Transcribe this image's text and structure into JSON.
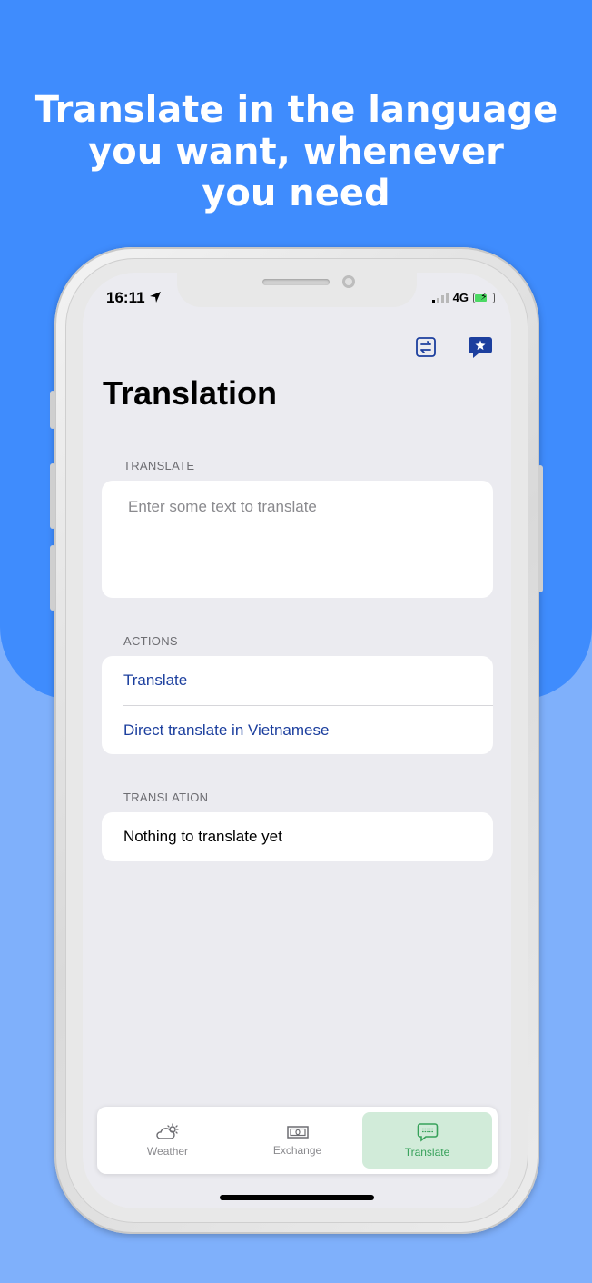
{
  "headline": {
    "line1": "Translate in the language",
    "line2": "you want, whenever",
    "line3": "you need"
  },
  "status_bar": {
    "time": "16:11",
    "network": "4G"
  },
  "nav": {
    "swap_icon": "swap-languages-icon",
    "favorites_icon": "star-bubble-icon"
  },
  "title": "Translation",
  "translate_section": {
    "header": "TRANSLATE",
    "placeholder": "Enter some text to translate",
    "value": ""
  },
  "actions_section": {
    "header": "ACTIONS",
    "items": [
      {
        "label": "Translate"
      },
      {
        "label": "Direct translate in Vietnamese"
      }
    ]
  },
  "translation_section": {
    "header": "TRANSLATION",
    "result": "Nothing to translate yet"
  },
  "tabs": [
    {
      "label": "Weather",
      "icon": "cloud-sun-icon",
      "active": false
    },
    {
      "label": "Exchange",
      "icon": "banknote-icon",
      "active": false
    },
    {
      "label": "Translate",
      "icon": "chat-bubble-icon",
      "active": true
    }
  ],
  "colors": {
    "background_top": "#3f8cfd",
    "background_bottom": "#7fb0fb",
    "action_text": "#1c3f9e",
    "active_tab_bg": "#d1ebd9",
    "active_tab_text": "#37a15a"
  }
}
